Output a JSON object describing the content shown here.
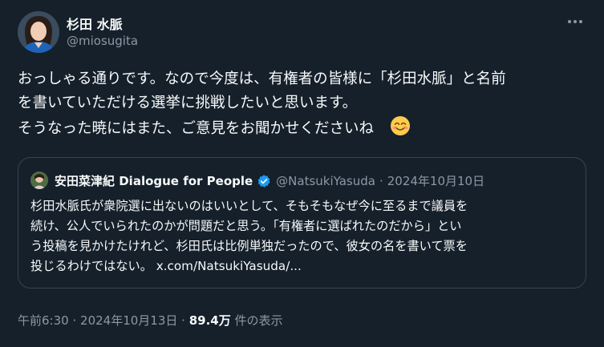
{
  "author": {
    "name": "杉田 水脈",
    "handle": "@miosugita"
  },
  "tweet": {
    "lines": [
      "おっしゃる通りです。なので今度は、有権者の皆様に「杉田水脈」と名前",
      "を書いていただける選挙に挑戦したいと思います。",
      "そうなった暁にはまた、ご意見をお聞かせくださいね"
    ],
    "emoji": "smiling-face-emoji"
  },
  "quote": {
    "name": "安田菜津紀 Dialogue for People",
    "handle": "@NatsukiYasuda",
    "separator": "·",
    "date": "2024年10月10日",
    "lines": [
      "杉田水脈氏が衆院選に出ないのはいいとして、そもそもなぜ今に至るまで議員を",
      "続け、公人でいられたのかが問題だと思う。「有権者に選ばれたのだから」とい",
      "う投稿を見かけたけれど、杉田氏は比例単独だったので、彼女の名を書いて票を",
      "投じるわけではない。"
    ],
    "link": "x.com/NatsukiYasuda/..."
  },
  "meta": {
    "time": "午前6:30",
    "separator": "·",
    "date": "2024年10月13日",
    "views_count": "89.4万",
    "views_label": "件の表示"
  },
  "colors": {
    "background": "#15202b",
    "text": "#f7f9f9",
    "secondary": "#8b98a5",
    "border": "#38444d",
    "verified": "#1d9bf0"
  },
  "icons": {
    "more": "more-horizontal-icon",
    "verified": "verified-badge-icon"
  }
}
